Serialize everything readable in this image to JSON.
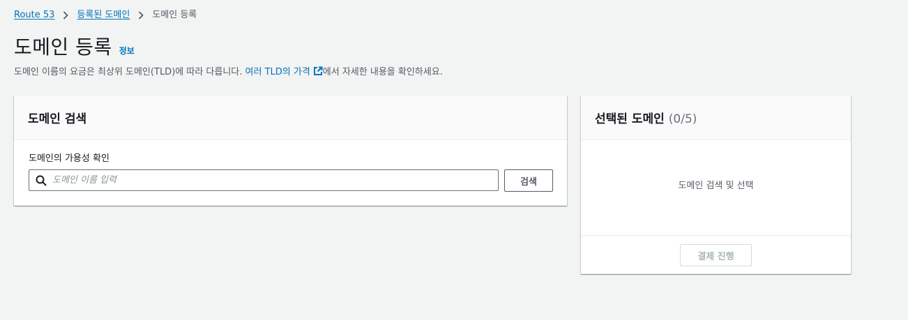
{
  "breadcrumb": {
    "items": [
      {
        "label": "Route 53"
      },
      {
        "label": "등록된 도메인"
      },
      {
        "label": "도메인 등록"
      }
    ]
  },
  "header": {
    "title": "도메인 등록",
    "info_link": "정보",
    "description_prefix": "도메인 이름의 요금은 최상위 도메인(TLD)에 따라 다릅니다. ",
    "description_link": "여러 TLD의 가격",
    "description_suffix": "에서 자세한 내용을 확인하세요."
  },
  "search_panel": {
    "title": "도메인 검색",
    "field_label": "도메인의 가용성 확인",
    "input_placeholder": "도메인 이름 입력",
    "input_value": "",
    "search_button": "검색"
  },
  "selected_panel": {
    "title": "선택된 도메인",
    "count": "(0/5)",
    "empty_text": "도메인 검색 및 선택",
    "checkout_button": "결제 진행"
  },
  "colors": {
    "link": "#0073bb",
    "background": "#f2f3f3",
    "text": "#16191f",
    "muted": "#545b64"
  }
}
